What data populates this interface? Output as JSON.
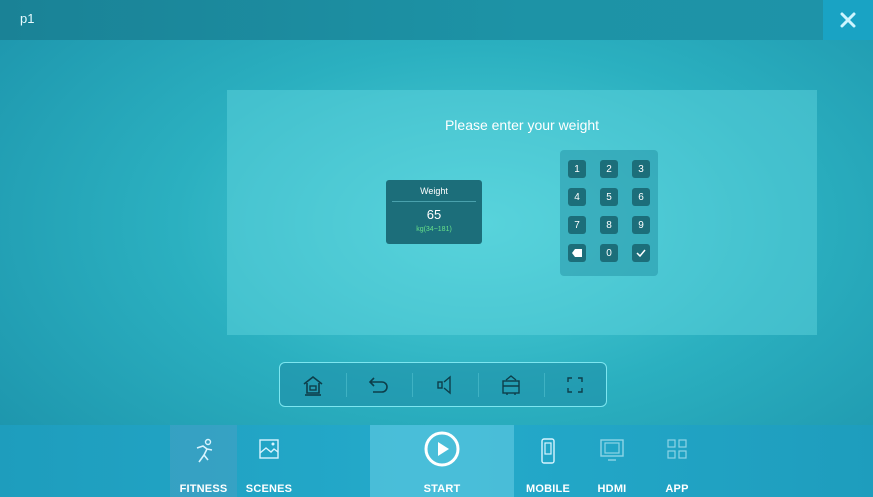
{
  "window": {
    "title": "p1"
  },
  "dialog": {
    "prompt": "Please enter your weight",
    "weight": {
      "label": "Weight",
      "value": "65",
      "range": "kg(34~181)"
    },
    "keypad": [
      "1",
      "2",
      "3",
      "4",
      "5",
      "6",
      "7",
      "8",
      "9",
      "backspace",
      "0",
      "confirm"
    ],
    "keypad_labels": {
      "k1": "1",
      "k2": "2",
      "k3": "3",
      "k4": "4",
      "k5": "5",
      "k6": "6",
      "k7": "7",
      "k8": "8",
      "k9": "9",
      "k0": "0"
    }
  },
  "toolbar": {
    "items": [
      "home-icon",
      "back-icon",
      "volume-icon",
      "cast-icon",
      "fullscreen-icon"
    ]
  },
  "bottom_nav": {
    "fitness": "FITNESS",
    "scenes": "SCENES",
    "start": "START",
    "mobile": "MOBILE",
    "hdmi": "HDMI",
    "app": "APP"
  },
  "colors": {
    "accent": "#19a3c4",
    "panel_key": "#1c6e7a",
    "range_text": "#67e08a"
  }
}
